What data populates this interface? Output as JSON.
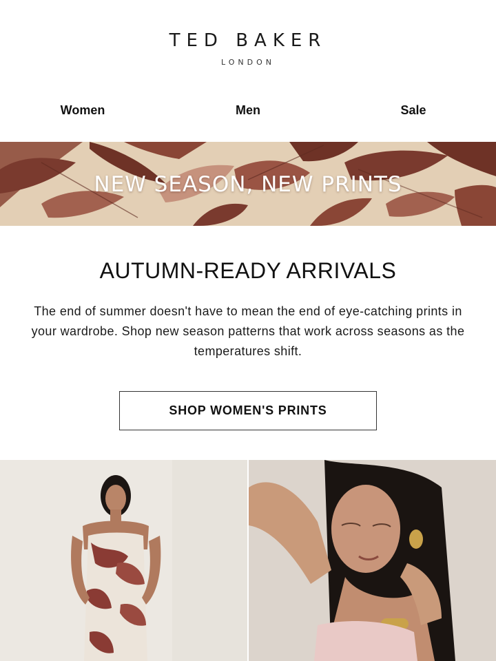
{
  "header": {
    "brand_name": "TED BAKER",
    "brand_sub": "LONDON"
  },
  "nav": {
    "items": [
      {
        "label": "Women"
      },
      {
        "label": "Men"
      },
      {
        "label": "Sale"
      }
    ]
  },
  "banner": {
    "text": "NEW SEASON, NEW PRINTS",
    "colors": {
      "base": "#e6d2b8",
      "leaf_dark": "#7a3a2e",
      "leaf_mid": "#9a5444"
    }
  },
  "main": {
    "headline": "AUTUMN-READY ARRIVALS",
    "body": "The end of summer doesn't have to mean the end of eye-catching prints in your wardrobe. Shop new season patterns that work across seasons as the temperatures shift.",
    "cta_label": "SHOP WOMEN'S PRINTS"
  },
  "products": [
    {
      "image": "model-in-leaf-print-slip-dress"
    },
    {
      "image": "model-wearing-gold-earring-and-bangle"
    }
  ]
}
